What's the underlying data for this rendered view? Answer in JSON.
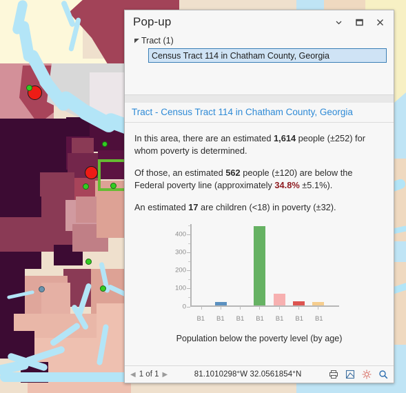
{
  "window": {
    "title": "Pop-up",
    "controls": [
      {
        "name": "chevron-down-icon",
        "label": "Collapse"
      },
      {
        "name": "maximize-icon",
        "label": "Maximize"
      },
      {
        "name": "close-icon",
        "label": "Close"
      }
    ]
  },
  "tree": {
    "group_label": "Tract (1)",
    "selected_item": "Census Tract 114 in Chatham County, Georgia"
  },
  "record": {
    "header": "Tract - Census Tract 114 in Chatham County, Georgia",
    "paragraphs": [
      {
        "parts": [
          {
            "t": "In this area, there are an estimated ",
            "s": "n"
          },
          {
            "t": "1,614",
            "s": "b"
          },
          {
            "t": " people (±252) for whom poverty is determined.",
            "s": "n"
          }
        ]
      },
      {
        "parts": [
          {
            "t": "Of those, an estimated ",
            "s": "n"
          },
          {
            "t": "562",
            "s": "b"
          },
          {
            "t": " people (±120) are below the Federal poverty line (approximately ",
            "s": "n"
          },
          {
            "t": "34.8%",
            "s": "p"
          },
          {
            "t": " ±5.1%).",
            "s": "n"
          }
        ]
      },
      {
        "parts": [
          {
            "t": "An estimated ",
            "s": "n"
          },
          {
            "t": "17",
            "s": "b"
          },
          {
            "t": " are children (<18) in poverty (±32).",
            "s": "n"
          }
        ]
      }
    ]
  },
  "chart_data": {
    "type": "bar",
    "title": "",
    "caption": "Population below the poverty level (by age)",
    "xlabel": "",
    "ylabel": "",
    "categories": [
      "B1",
      "B1",
      "B1",
      "B1",
      "B1",
      "B1",
      "B1"
    ],
    "values": [
      0,
      17,
      0,
      440,
      62,
      22,
      18
    ],
    "colors": [
      "#7fb2d9",
      "#5b91c0",
      "#7fb2d9",
      "#66b263",
      "#f7b0b0",
      "#dd5450",
      "#f6cd8e"
    ],
    "yticks": [
      0,
      100,
      200,
      300,
      400
    ],
    "ylim": [
      0,
      460
    ],
    "grid": false,
    "legend": "none"
  },
  "footer": {
    "page_label": "1 of 1",
    "prev_arrow": "◀",
    "next_arrow": "▶",
    "coordinates": "81.1010298°W 32.0561854°N",
    "tools": [
      {
        "name": "print-icon",
        "label": "Print"
      },
      {
        "name": "clip-layer-icon",
        "label": "Clip"
      },
      {
        "name": "zoom-to-icon",
        "label": "Zoom to"
      },
      {
        "name": "magnifier-icon",
        "label": "Magnify"
      }
    ]
  },
  "map": {
    "selection_box_color": "#66bb33",
    "marker_color": "#ee1c16",
    "point_color": "#33cc22",
    "water_color": "#b3e5f7"
  },
  "colors": {
    "accent": "#2e8ad6",
    "percent": "#8f1d22",
    "panel_bg": "#f7f7f7",
    "select_bg": "#cfe3f5"
  }
}
